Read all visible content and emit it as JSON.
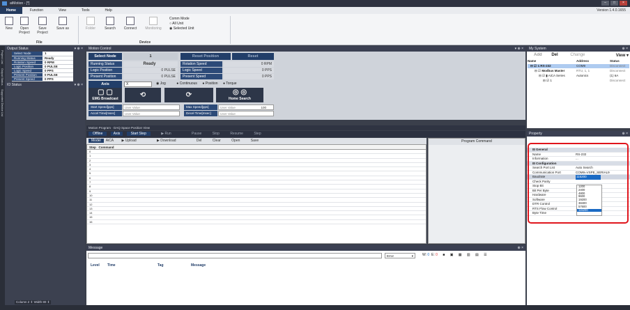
{
  "window": {
    "title": "atMotion - [*]",
    "version": "Version 1.4.0.1655"
  },
  "menu": {
    "home": "Home",
    "function": "Function",
    "view": "View",
    "tools": "Tools",
    "help": "Help"
  },
  "ribbon": {
    "new": "New",
    "open": "Open Project",
    "save": "Save Project",
    "save_as": "Save as",
    "folder": "Folder",
    "search": "Search",
    "connect": "Connect",
    "monitoring": "Monitoring",
    "comm_mode": "Comm Mode",
    "all_unit": "All Unit",
    "selected_unit": "Selected Unit",
    "group_file": "File",
    "group_device": "Device"
  },
  "side_tabs": [
    "Project List",
    "Output Status",
    "Supported Device List"
  ],
  "output_status": {
    "title": "Output Status",
    "rows": [
      {
        "label": "Select Node",
        "value": "1"
      },
      {
        "label": "Running Status",
        "value": "Ready"
      },
      {
        "label": "Rotation Speed",
        "value": "0  RPM"
      },
      {
        "label": "Logic Position",
        "value": "0  PULSE"
      },
      {
        "label": "Logic Speed",
        "value": "0  PPS"
      },
      {
        "label": "Present Position",
        "value": "0  PULSE"
      },
      {
        "label": "Present Speed",
        "value": "0  PPS"
      }
    ],
    "io_title": "IO Status"
  },
  "bottom_left": {
    "column_label": "Column",
    "column_value": "2",
    "width_label": "Width",
    "width_value": "80"
  },
  "motion": {
    "title": "Motion Control",
    "select_node": "Select Node",
    "node_value": "1",
    "reset_position": "Reset Position",
    "reset": "Reset",
    "running_status": "Running Status",
    "status_value": "Ready",
    "rotation_speed": "Rotation Speed",
    "rotation_value": "0  RPM",
    "logic_position": "Logic Position",
    "logic_position_value": "0  PULSE",
    "logic_speed": "Logic Speed",
    "logic_speed_value": "0  PPS",
    "present_position": "Present Position",
    "present_position_value": "0  PULSE",
    "present_speed": "Present Speed",
    "present_speed_value": "0  PPS",
    "axis": "Axis",
    "axis_value": "X",
    "jog": "Jog",
    "continuous": "Continuous",
    "position": "Position",
    "torque": "Torque",
    "emg": "EMG",
    "broadcast": "Broadcast",
    "home_search": "Home Search",
    "start_speed": "Start Speed[pps]",
    "accel_time": "Accel Time[msec]",
    "max_speed": "Max Speed[pps]",
    "decel_time": "Decel Time[msec]",
    "user_value": "User Value",
    "max_speed_value": "100"
  },
  "program": {
    "tabs": "Motion Program  ·  DAQ Space  Position View",
    "offline": "Offline",
    "axis": "Axis",
    "start_step": "Start Step",
    "run": "Run",
    "pause": "Pause",
    "stop": "Stop",
    "resume": "Resume",
    "step": "Step",
    "model": "Model",
    "model_value": "AiCA",
    "upload": "Upload",
    "download": "Download",
    "del": "Del",
    "clear": "Clear",
    "open": "Open",
    "save": "Save",
    "col_step": "Step",
    "col_command": "Command",
    "program_command": "Program Command",
    "steps": [
      "0",
      "1",
      "2",
      "3",
      "4",
      "5",
      "6",
      "7",
      "8",
      "9",
      "10",
      "11",
      "12",
      "13",
      "14",
      "15",
      "16"
    ]
  },
  "message": {
    "title": "Message",
    "filter": "Error",
    "cols": {
      "level": "Level",
      "time": "Time",
      "tag": "Tag",
      "message": "Message"
    },
    "counts": {
      "w": "W:",
      "w_val": "0",
      "e": "E:",
      "e_val": "0"
    }
  },
  "system": {
    "title": "My System",
    "add": "Add",
    "del": "Del",
    "change": "Change",
    "view": "View",
    "col_name": "Name",
    "col_address": "Address",
    "col_status": "Status",
    "rows": [
      {
        "name": "1:RS-232",
        "address": "COM9",
        "status": "Disconnect"
      },
      {
        "name": "Modbus Master",
        "address": "RTU, 1, 1",
        "status": "Disconnect"
      },
      {
        "name": "AiCA Series",
        "address": "Autonics",
        "status": "(1) 6A"
      },
      {
        "name": "1",
        "address": "",
        "status": "Disconnect"
      }
    ]
  },
  "property": {
    "title": "Property",
    "general": "General",
    "name": "Name",
    "name_value": "RS-232",
    "information": "Information",
    "information_value": "...",
    "configuration": "Configuration",
    "search_port_list": "Search Port List",
    "search_port_value": "Auto Search",
    "communication_port": "Communication Port",
    "communication_port_value": "COM9=VSPE_SERIAL9",
    "baudrate": "Baudrate",
    "baudrate_value": "115200",
    "check_parity": "Check Parity",
    "stop_bit": "Stop Bit",
    "bit_per_byte": "Bit Per Byte",
    "hardware": "Hardware",
    "software": "Software",
    "dtr_control": "DTR Control",
    "rts_flow": "RTS Flow Control",
    "byte_time": "Byte Time",
    "baud_options": [
      "1200",
      "2400",
      "4800",
      "9600",
      "19200",
      "38400",
      "57600",
      "115200"
    ],
    "baud_selected": "115200"
  },
  "colors": {
    "accent": "#2c4a78",
    "highlight": "#e0151c",
    "selected": "#1a6ac4"
  }
}
